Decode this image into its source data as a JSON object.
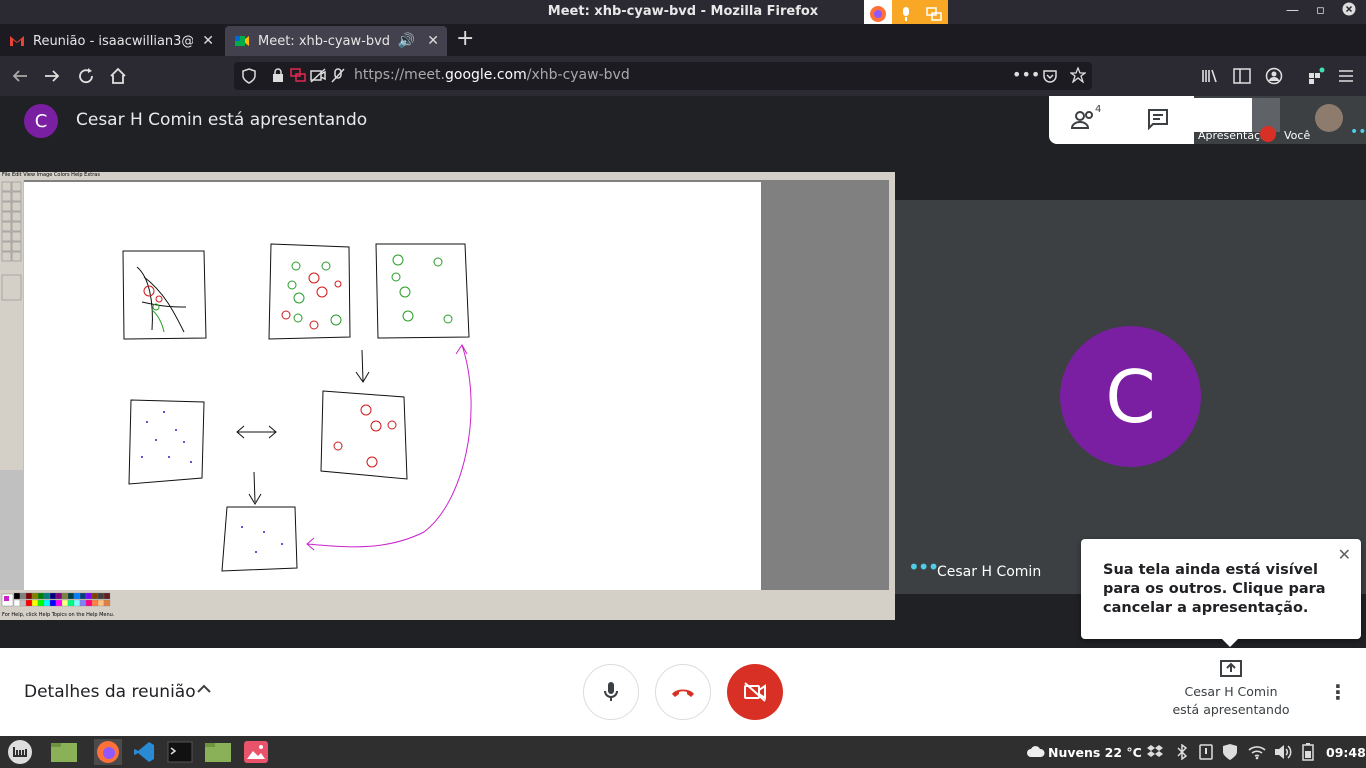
{
  "window": {
    "title": "Meet: xhb-cyaw-bvd - Mozilla Firefox"
  },
  "tabs": [
    {
      "title": "Reunião - isaacwillian3@gm",
      "active": false
    },
    {
      "title": "Meet: xhb-cyaw-bvd",
      "active": true
    }
  ],
  "navbar": {
    "url_prefix": "https://meet.",
    "url_domain": "google.com",
    "url_path": "/xhb-cyaw-bvd"
  },
  "meet": {
    "presenter_initial": "C",
    "presenter_banner": "Cesar H Comin está apresentando",
    "participants_count": "4",
    "thumb_presentation_label": "Apresentação",
    "thumb_self_label": "Você",
    "tile_name": "Cesar H Comin",
    "tile_initial": "C",
    "tooltip_text": "Sua tela ainda está visível para os outros. Clique para cancelar a apresentação.",
    "details_label": "Detalhes da reunião",
    "presenting_line1": "Cesar H Comin",
    "presenting_line2": "está apresentando"
  },
  "paint": {
    "menu": "File  Edit  View  Image  Colors  Help  Extras",
    "status": "For Help, click Help Topics on the Help Menu."
  },
  "taskbar": {
    "weather": "Nuvens 22 °C",
    "clock": "09:48"
  },
  "colors": {
    "accent_purple": "#7b1fa2",
    "end_call_red": "#d93025",
    "meet_dark": "#202124"
  }
}
